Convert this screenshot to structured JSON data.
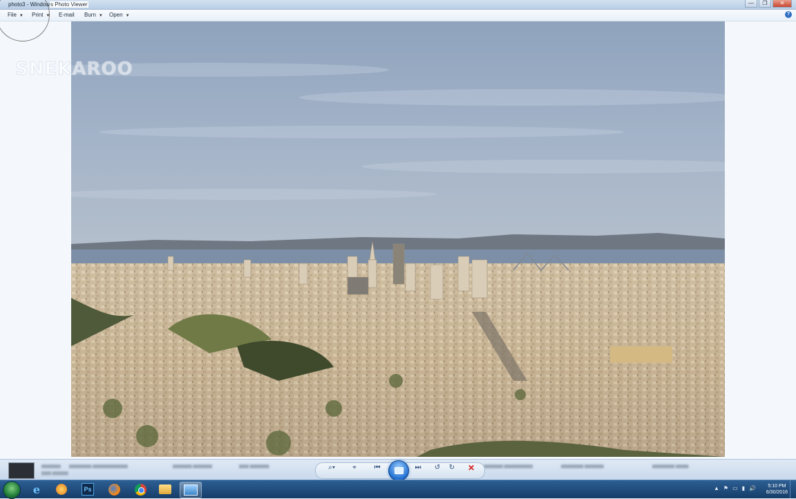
{
  "window": {
    "title_prefix": "photo3 - Window",
    "title_highlight": "s Photo Viewer",
    "controls": [
      "—",
      "❐",
      "✕"
    ]
  },
  "menu": {
    "items": [
      {
        "label": "File",
        "has_dropdown": true
      },
      {
        "label": "Print",
        "has_dropdown": true
      },
      {
        "label": "E-mail",
        "has_dropdown": false
      },
      {
        "label": "Burn",
        "has_dropdown": true
      },
      {
        "label": "Open",
        "has_dropdown": true
      }
    ],
    "help_icon": "help-icon",
    "help_glyph": "?"
  },
  "photo": {
    "subject": "Aerial view of San Francisco skyline",
    "watermark": "SNEKAROO"
  },
  "controls": {
    "buttons": [
      {
        "name": "zoom",
        "glyph": "⌕▾"
      },
      {
        "name": "actual-size",
        "glyph": "⌖"
      },
      {
        "name": "previous",
        "glyph": "⏮"
      },
      {
        "name": "slideshow",
        "glyph": ""
      },
      {
        "name": "next",
        "glyph": "⏭"
      },
      {
        "name": "rotate-counterclockwise",
        "glyph": "↺"
      },
      {
        "name": "rotate-clockwise",
        "glyph": "↻"
      },
      {
        "name": "delete",
        "glyph": "✕"
      }
    ]
  },
  "taskbar": {
    "apps": [
      "ie-icon",
      "media-player-icon",
      "photoshop-icon",
      "firefox-icon",
      "chrome-icon",
      "explorer-icon",
      "photo-viewer-icon"
    ],
    "photoshop_label": "Ps",
    "tray_icons": [
      "▲",
      "⚑",
      "▭",
      "▮",
      "🔊"
    ],
    "time": "5:10 PM",
    "date": "6/30/2016"
  },
  "colors": {
    "sky": "#9eb1c8",
    "accent": "#1f6ed1",
    "taskbar": "#1e4b7c"
  }
}
